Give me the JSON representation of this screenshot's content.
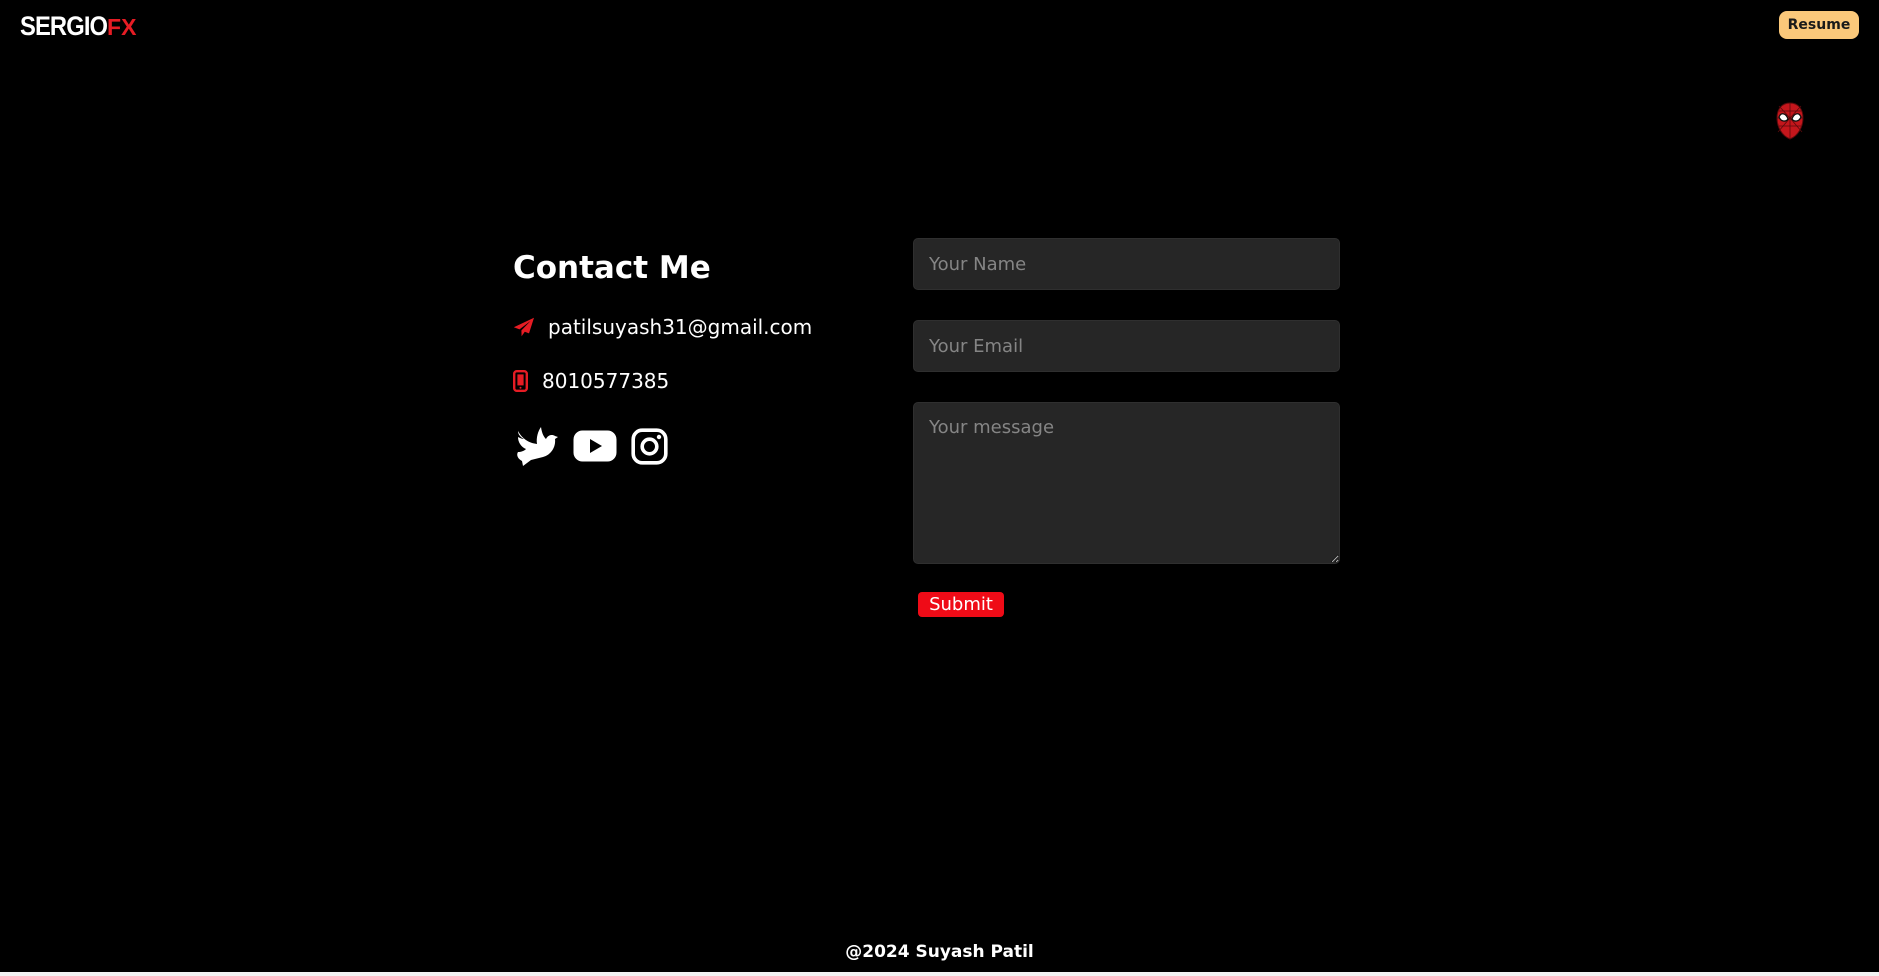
{
  "header": {
    "logo_main": "SERGIO",
    "logo_accent": "FX",
    "resume_label": "Resume",
    "mask_icon": "spiderman-mask-icon"
  },
  "contact": {
    "title": "Contact Me",
    "email": "patilsuyash31@gmail.com",
    "email_icon": "paper-plane-icon",
    "phone": "8010577385",
    "phone_icon": "mobile-phone-icon",
    "socials": [
      {
        "icon": "dove-icon"
      },
      {
        "icon": "youtube-icon"
      },
      {
        "icon": "instagram-icon"
      }
    ]
  },
  "form": {
    "name_placeholder": "Your Name",
    "email_placeholder": "Your Email",
    "message_placeholder": "Your message",
    "submit_label": "Submit"
  },
  "footer": {
    "text": "@2024 Suyash Patil"
  },
  "colors": {
    "background": "#000000",
    "accent_red": "#e61c24",
    "resume_button": "#fbc87a",
    "input_background": "#262626",
    "submit_button": "#ef0b17"
  }
}
